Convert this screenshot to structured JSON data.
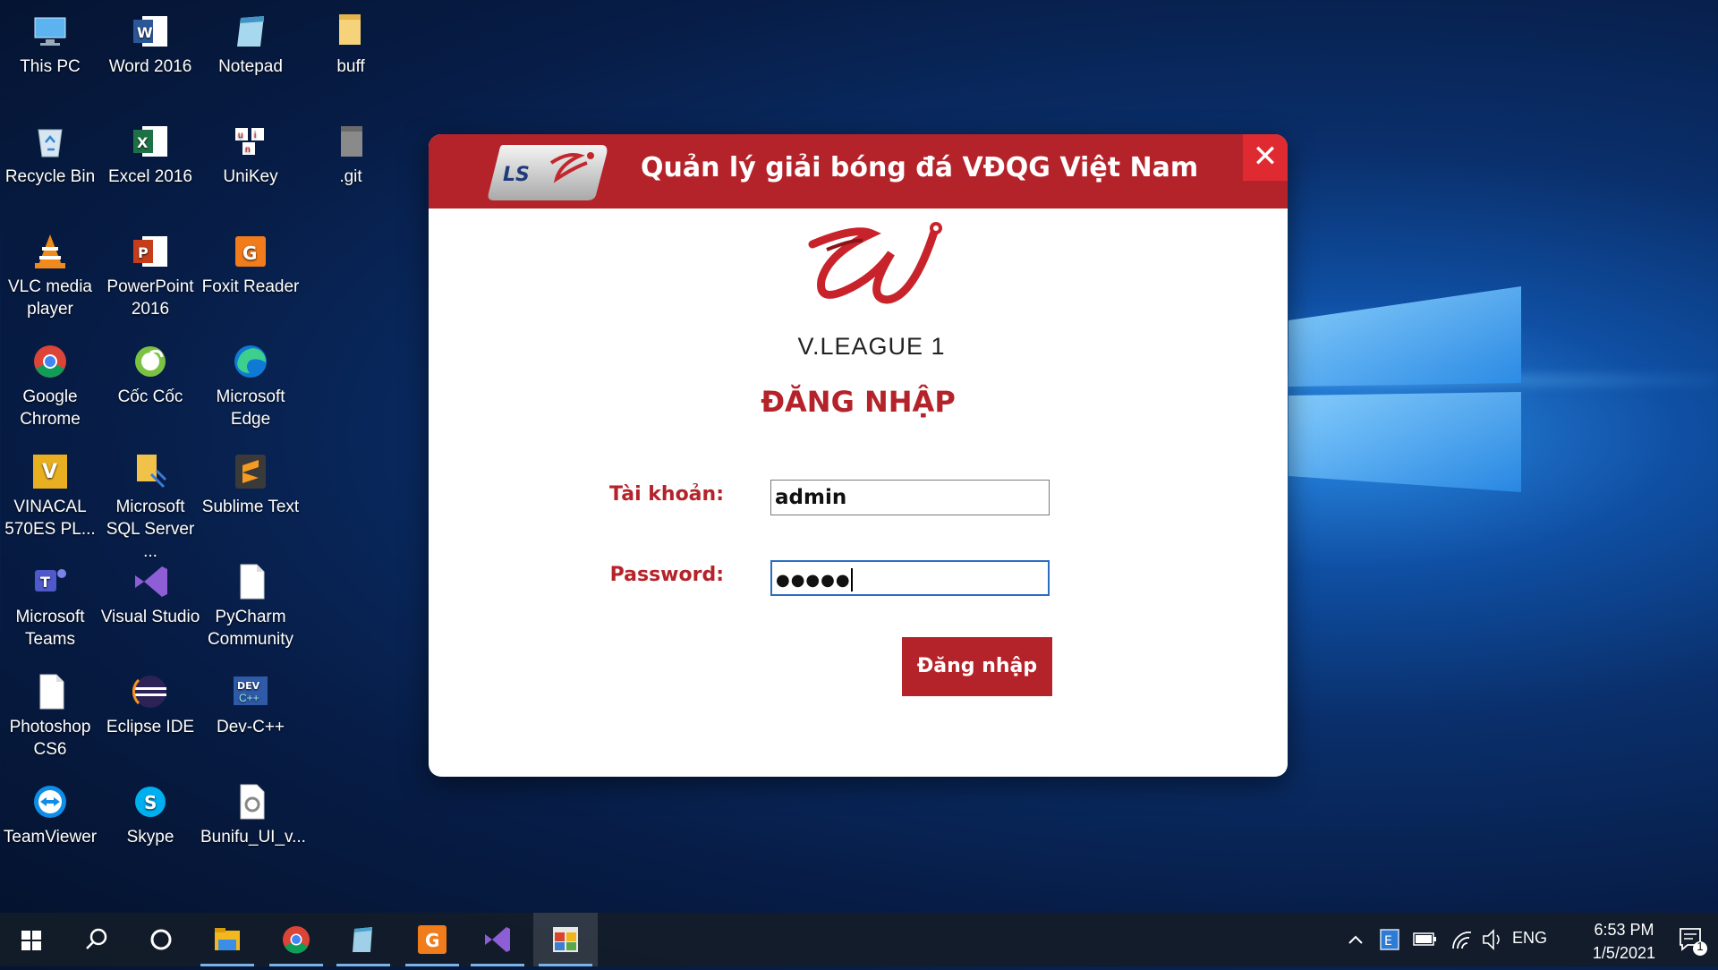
{
  "desktop": {
    "icons": [
      {
        "label": "This PC",
        "icon": "this-pc-icon"
      },
      {
        "label": "Word 2016",
        "icon": "word-icon"
      },
      {
        "label": "Notepad",
        "icon": "notepad-icon"
      },
      {
        "label": "buff",
        "icon": "folder-icon"
      },
      {
        "label": "Recycle Bin",
        "icon": "recycle-bin-icon"
      },
      {
        "label": "Excel 2016",
        "icon": "excel-icon"
      },
      {
        "label": "UniKey",
        "icon": "unikey-icon"
      },
      {
        "label": ".git",
        "icon": "git-folder-icon"
      },
      {
        "label": "VLC media\nplayer",
        "icon": "vlc-icon"
      },
      {
        "label": "PowerPoint\n2016",
        "icon": "powerpoint-icon"
      },
      {
        "label": "Foxit Reader",
        "icon": "foxit-icon"
      },
      {
        "label": "Google\nChrome",
        "icon": "chrome-icon"
      },
      {
        "label": "Cốc Cốc",
        "icon": "coccoc-icon"
      },
      {
        "label": "Microsoft\nEdge",
        "icon": "edge-icon"
      },
      {
        "label": "VINACAL\n570ES PL...",
        "icon": "vinacal-icon"
      },
      {
        "label": "Microsoft\nSQL Server ...",
        "icon": "sql-server-icon"
      },
      {
        "label": "Sublime Text",
        "icon": "sublime-icon"
      },
      {
        "label": "Microsoft\nTeams",
        "icon": "teams-icon"
      },
      {
        "label": "Visual Studio",
        "icon": "visual-studio-icon"
      },
      {
        "label": "PyCharm\nCommunity",
        "icon": "file-icon"
      },
      {
        "label": "Photoshop\nCS6",
        "icon": "file-icon"
      },
      {
        "label": "Eclipse IDE",
        "icon": "eclipse-icon"
      },
      {
        "label": "Dev-C++",
        "icon": "devcpp-icon"
      },
      {
        "label": "TeamViewer",
        "icon": "teamviewer-icon"
      },
      {
        "label": "Skype",
        "icon": "skype-icon"
      },
      {
        "label": "Bunifu_UI_v...",
        "icon": "settings-file-icon"
      }
    ]
  },
  "dialog": {
    "title": "Quản lý giải bóng đá VĐQG Việt Nam",
    "close": "✕",
    "logo_text": "V.LEAGUE 1",
    "login_title": "ĐĂNG NHẬP",
    "username_label": "Tài khoản:",
    "username_value": "admin",
    "password_label": "Password:",
    "password_value": "●●●●●",
    "submit_label": "Đăng nhập"
  },
  "taskbar": {
    "language": "ENG",
    "time": "6:53 PM",
    "date": "1/5/2021",
    "notification_count": "1"
  },
  "colors": {
    "brand_red": "#b5232a",
    "close_red": "#e02a32",
    "focus_blue": "#2c6cc0"
  }
}
